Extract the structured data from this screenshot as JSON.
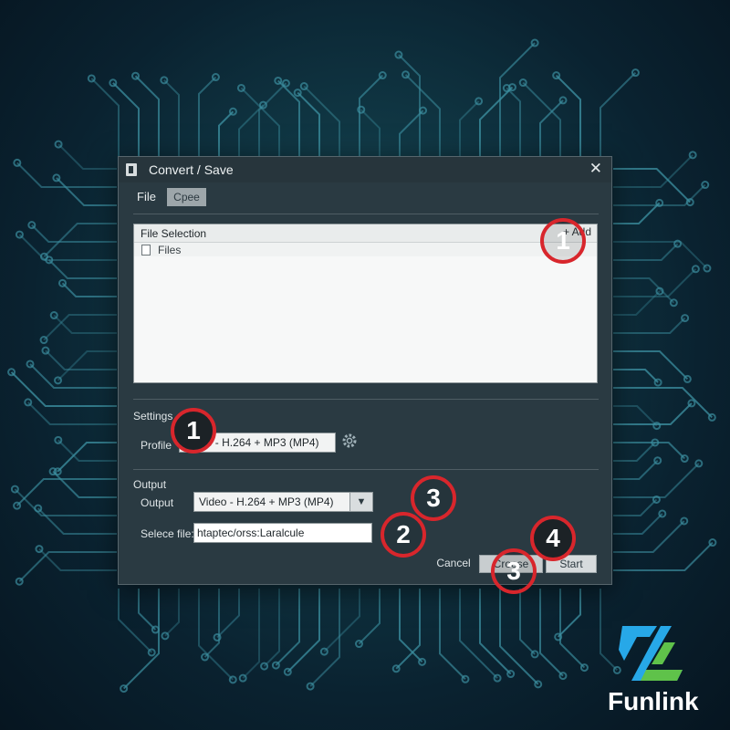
{
  "dialog": {
    "title": "Convert / Save",
    "tabs": [
      "File",
      "Cpee"
    ],
    "file_selection": {
      "title": "File Selection",
      "add_label": "+ Add",
      "files_label": "Files"
    },
    "settings": {
      "heading": "Settings",
      "profile_label": "Profile",
      "profile_value": "Video - H.264 + MP3 (MP4)"
    },
    "output": {
      "heading": "Output",
      "output_label": "Output",
      "output_value": "Video - H.264 + MP3 (MP4)",
      "select_file_label": "Selece file:",
      "select_file_value": "htaptec/orss:Laralcule"
    },
    "buttons": {
      "cancel": "Cancel",
      "choose": "Croose",
      "start": "Start"
    }
  },
  "markers": [
    "1",
    "1",
    "2",
    "3",
    "3",
    "4"
  ],
  "brand": {
    "name": "Funlink",
    "colors": {
      "blue": "#27a8e8",
      "green": "#5fc24a"
    }
  },
  "colors": {
    "background": "#0d2a36",
    "circuit": "#3c8fa0",
    "marker": "#d8262c"
  }
}
